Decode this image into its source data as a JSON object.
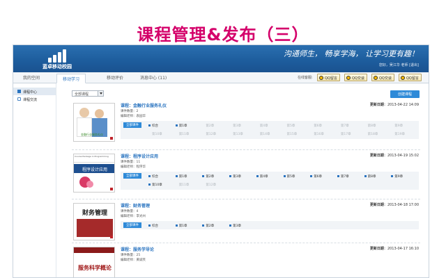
{
  "slide": {
    "title": "课程管理&发布（三）"
  },
  "header": {
    "logo_text": "蓝卓移动校园",
    "slogan": "沟通师生， 畅享学海， 让学习更有趣！",
    "user_line": "您好，吴江华 老师 [退出]"
  },
  "tabs": [
    "我的空间",
    "移动学习",
    "移动评价",
    "消息中心 (11)"
  ],
  "active_tab": 1,
  "online": {
    "label": "在线客服:",
    "qq_buttons": [
      "QQ留言",
      "QQ交谈",
      "QQ交谈",
      "QQ留言"
    ]
  },
  "sidebar": {
    "items": [
      {
        "label": "课程中心",
        "icon": "course-center-icon"
      },
      {
        "label": "课程交流",
        "icon": "chat-icon"
      }
    ]
  },
  "toolbar": {
    "filter_value": "全部课程",
    "create_label": "创建课程"
  },
  "labels": {
    "count": "课件数量",
    "editor": "编辑老师",
    "updated": "更新日期",
    "all_chapters": "全部课件"
  },
  "courses": [
    {
      "title": "课程：金融行业服务礼仪",
      "count": "2",
      "editor": "袁园华",
      "date": "2013-04-22 14:09",
      "chapters": [
        "综合",
        "第1章",
        "第2章",
        "第3章",
        "第4章",
        "第5章",
        "第6章",
        "第7章",
        "第8章",
        "第9章",
        "第10章",
        "第11章",
        "第12章",
        "第13章",
        "第14章",
        "第15章",
        "第16章",
        "第17章",
        "第18章",
        "第19章"
      ],
      "filled": 2,
      "thumb_caption": "金融行业服务礼仪"
    },
    {
      "title": "课程：程序设计应用",
      "count": "11",
      "editor": "程序华",
      "date": "2013-04-19 15:02",
      "chapters": [
        "综合",
        "第1章",
        "第2章",
        "第3章",
        "第4章",
        "第5章",
        "第6章",
        "第7章",
        "第8章",
        "第9章",
        "第10章",
        "第11章",
        "第12章"
      ],
      "filled": 11,
      "thumb_caption": "程序设计应用",
      "thumb_header": "Course Package in Programming"
    },
    {
      "title": "课程：财务管理",
      "count": "4",
      "editor": "李光州",
      "date": "2013-04-18 17:00",
      "chapters": [
        "综合",
        "第1章",
        "第2章",
        "第3章"
      ],
      "filled": 4,
      "thumb_caption": "财务管理"
    },
    {
      "title": "课程：服务学导论",
      "count": "25",
      "editor": "黄诚笑",
      "date": "2013-04-17 16:10",
      "chapters": [],
      "filled": 0,
      "thumb_caption": "服务科学概论"
    }
  ],
  "colors": {
    "title": "#d4006a",
    "banner": "#1d5c9c",
    "accent": "#2e8ad8",
    "link": "#2a74c0"
  }
}
